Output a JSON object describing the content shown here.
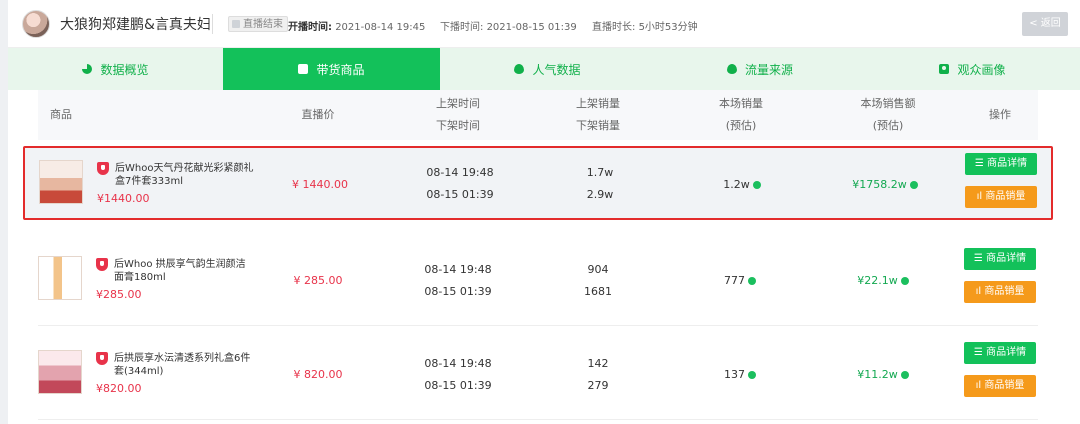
{
  "header": {
    "streamer_name": "大狼狗郑建鹏&言真夫妇",
    "status": "直播结束",
    "start_label": "开播时间:",
    "start_value": "2021-08-14 19:45",
    "end_label": "下播时间:",
    "end_value": "2021-08-15 01:39",
    "duration_label": "直播时长:",
    "duration_value": "5小时53分钟",
    "back_label": "< 返回"
  },
  "tabs": [
    {
      "label": "数据概览",
      "icon": "pie-icon"
    },
    {
      "label": "带货商品",
      "icon": "box-icon",
      "active": true
    },
    {
      "label": "人气数据",
      "icon": "drop-icon"
    },
    {
      "label": "流量来源",
      "icon": "drop-icon"
    },
    {
      "label": "观众画像",
      "icon": "user-card-icon"
    }
  ],
  "columns": {
    "product": "商品",
    "live_price": "直播价",
    "time_up": "上架时间",
    "time_down": "下架时间",
    "sales_up": "上架销量",
    "sales_down": "下架销量",
    "session_sales": "本场销量",
    "session_sales_sub": "(预估)",
    "session_revenue": "本场销售额",
    "session_revenue_sub": "(预估)",
    "actions": "操作"
  },
  "rows": [
    {
      "name": "后Whoo天气丹花献光彩紧颜礼盒7件套333ml",
      "price": "¥1440.00",
      "live_price": "¥ 1440.00",
      "time_up": "08-14 19:48",
      "time_down": "08-15 01:39",
      "sales_up": "1.7w",
      "sales_down": "2.9w",
      "session_sales": "1.2w",
      "session_revenue": "¥1758.2w",
      "btn_detail": "☰ 商品详情",
      "btn_sales": "ıl 商品销量"
    },
    {
      "name": "后Whoo 拱辰享气韵生润颜洁面膏180ml",
      "price": "¥285.00",
      "live_price": "¥ 285.00",
      "time_up": "08-14 19:48",
      "time_down": "08-15 01:39",
      "sales_up": "904",
      "sales_down": "1681",
      "session_sales": "777",
      "session_revenue": "¥22.1w",
      "btn_detail": "☰ 商品详情",
      "btn_sales": "ıl 商品销量"
    },
    {
      "name": "后拱辰享水沄清透系列礼盒6件套(344ml)",
      "price": "¥820.00",
      "live_price": "¥ 820.00",
      "time_up": "08-14 19:48",
      "time_down": "08-15 01:39",
      "sales_up": "142",
      "sales_down": "279",
      "session_sales": "137",
      "session_revenue": "¥11.2w",
      "btn_detail": "☰ 商品详情",
      "btn_sales": "ıl 商品销量"
    }
  ]
}
